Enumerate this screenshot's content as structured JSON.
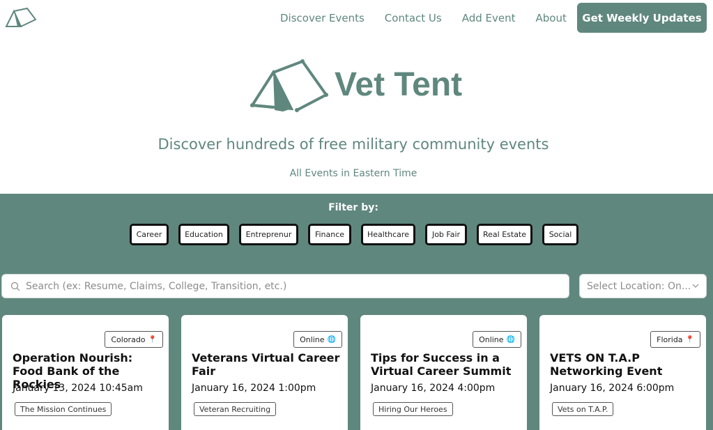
{
  "nav": {
    "links": [
      "Discover Events",
      "Contact Us",
      "Add Event",
      "About"
    ],
    "cta": "Get Weekly Updates"
  },
  "hero": {
    "title": "Vet Tent",
    "subtitle": "Discover hundreds of free military community events",
    "timezone": "All Events in Eastern Time"
  },
  "filters": {
    "label": "Filter by:",
    "options": [
      "Career",
      "Education",
      "Entreprenur",
      "Finance",
      "Healthcare",
      "Job Fair",
      "Real Estate",
      "Social"
    ]
  },
  "search": {
    "placeholder": "Search (ex: Resume, Claims, College, Transition, etc.)"
  },
  "location_select": {
    "value": "Select Location: On..."
  },
  "events": [
    {
      "location": "Colorado",
      "location_icon": "pin-icon",
      "title": "Operation Nourish: Food Bank of the Rockies",
      "date": "January 13, 2024 10:45am",
      "org": "The Mission Continues"
    },
    {
      "location": "Online",
      "location_icon": "globe-icon",
      "title": "Veterans Virtual Career Fair",
      "date": "January 16, 2024 1:00pm",
      "org": "Veteran Recruiting"
    },
    {
      "location": "Online",
      "location_icon": "globe-icon",
      "title": "Tips for Success in a Virtual Career Summit",
      "date": "January 16, 2024 4:00pm",
      "org": "Hiring Our Heroes"
    },
    {
      "location": "Florida",
      "location_icon": "pin-icon",
      "title": "VETS ON T.A.P Networking Event",
      "date": "January 16, 2024 6:00pm",
      "org": "Vets on T.A.P."
    }
  ],
  "colors": {
    "brand": "#5f877e",
    "pin": "#d9463b",
    "globe": "#4a90d9"
  }
}
